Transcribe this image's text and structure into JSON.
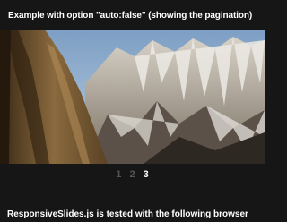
{
  "heading": "Example with option \"auto:false\" (showing the pagination)",
  "slideshow": {
    "image": "mountain-landscape",
    "pagination": [
      {
        "label": "1",
        "active": false
      },
      {
        "label": "2",
        "active": false
      },
      {
        "label": "3",
        "active": true
      }
    ]
  },
  "footer": "ResponsiveSlides.js is tested with the following browser",
  "colors": {
    "background": "#161616",
    "text": "#ffffff",
    "pager_inactive": "#555555",
    "pager_active": "#ffffff"
  }
}
